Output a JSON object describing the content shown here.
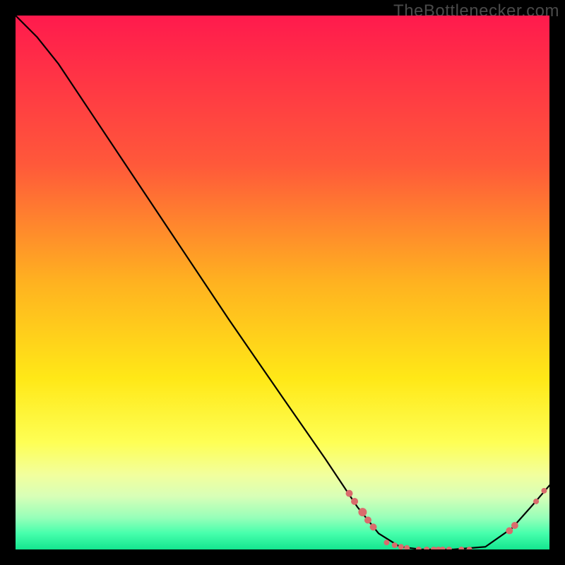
{
  "watermark": "TheBottlenecker.com",
  "chart_data": {
    "type": "line",
    "title": "",
    "xlabel": "",
    "ylabel": "",
    "xlim": [
      0,
      100
    ],
    "ylim": [
      0,
      100
    ],
    "gradient_stops": [
      {
        "offset": 0.0,
        "color": "#ff1a4d"
      },
      {
        "offset": 0.28,
        "color": "#ff593a"
      },
      {
        "offset": 0.5,
        "color": "#ffb220"
      },
      {
        "offset": 0.68,
        "color": "#ffe817"
      },
      {
        "offset": 0.8,
        "color": "#feff55"
      },
      {
        "offset": 0.86,
        "color": "#f2ff9d"
      },
      {
        "offset": 0.9,
        "color": "#d8ffb7"
      },
      {
        "offset": 0.94,
        "color": "#98ffb9"
      },
      {
        "offset": 0.97,
        "color": "#46ffac"
      },
      {
        "offset": 1.0,
        "color": "#14e58f"
      }
    ],
    "series": [
      {
        "name": "bottleneck-curve",
        "data": [
          {
            "x": 0,
            "y": 100.0
          },
          {
            "x": 4,
            "y": 96.0
          },
          {
            "x": 8,
            "y": 91.0
          },
          {
            "x": 12,
            "y": 85.0
          },
          {
            "x": 20,
            "y": 73.0
          },
          {
            "x": 30,
            "y": 58.0
          },
          {
            "x": 40,
            "y": 43.0
          },
          {
            "x": 50,
            "y": 28.5
          },
          {
            "x": 58,
            "y": 17.0
          },
          {
            "x": 64,
            "y": 8.0
          },
          {
            "x": 68,
            "y": 3.0
          },
          {
            "x": 72,
            "y": 0.5
          },
          {
            "x": 76,
            "y": 0.0
          },
          {
            "x": 82,
            "y": 0.0
          },
          {
            "x": 88,
            "y": 0.5
          },
          {
            "x": 93,
            "y": 4.0
          },
          {
            "x": 97,
            "y": 8.5
          },
          {
            "x": 100,
            "y": 12.0
          }
        ]
      }
    ],
    "markers": {
      "name": "data-points",
      "color": "#d96c6c",
      "points": [
        {
          "x": 62.5,
          "y": 10.5,
          "r": 5
        },
        {
          "x": 63.5,
          "y": 9.0,
          "r": 5
        },
        {
          "x": 65.0,
          "y": 7.0,
          "r": 6
        },
        {
          "x": 66.0,
          "y": 5.5,
          "r": 5
        },
        {
          "x": 67.0,
          "y": 4.2,
          "r": 5
        },
        {
          "x": 69.5,
          "y": 1.3,
          "r": 4
        },
        {
          "x": 71.0,
          "y": 0.8,
          "r": 4
        },
        {
          "x": 72.2,
          "y": 0.5,
          "r": 4
        },
        {
          "x": 73.3,
          "y": 0.3,
          "r": 4
        },
        {
          "x": 75.5,
          "y": 0.0,
          "r": 4
        },
        {
          "x": 77.0,
          "y": 0.0,
          "r": 4
        },
        {
          "x": 78.3,
          "y": 0.0,
          "r": 4
        },
        {
          "x": 79.2,
          "y": 0.0,
          "r": 4
        },
        {
          "x": 80.0,
          "y": 0.0,
          "r": 4
        },
        {
          "x": 81.2,
          "y": 0.0,
          "r": 4
        },
        {
          "x": 83.5,
          "y": 0.0,
          "r": 4
        },
        {
          "x": 85.0,
          "y": 0.0,
          "r": 4
        },
        {
          "x": 92.5,
          "y": 3.5,
          "r": 5
        },
        {
          "x": 93.5,
          "y": 4.5,
          "r": 5
        },
        {
          "x": 97.5,
          "y": 9.0,
          "r": 4
        },
        {
          "x": 99.0,
          "y": 11.0,
          "r": 4
        }
      ]
    }
  }
}
